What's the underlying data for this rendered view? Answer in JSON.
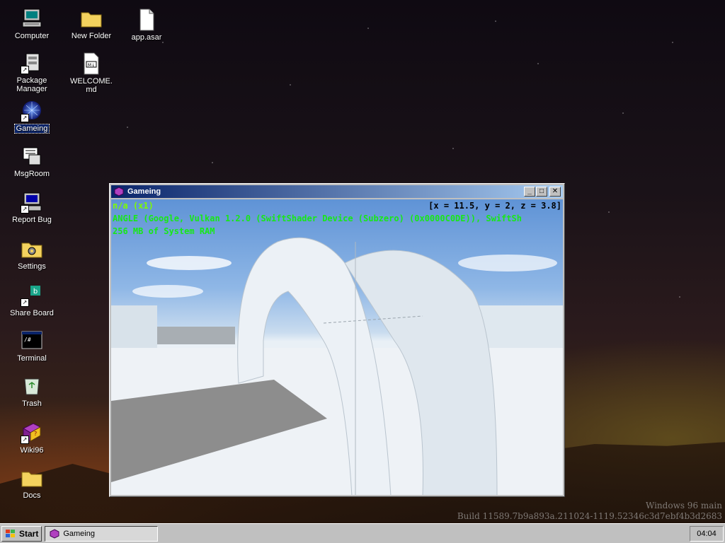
{
  "desktop": {
    "icons": [
      {
        "label": "Computer",
        "icon": "computer-icon"
      },
      {
        "label": "New Folder",
        "icon": "folder-icon"
      },
      {
        "label": "app.asar",
        "icon": "file-icon"
      },
      {
        "label": "Package Manager",
        "icon": "package-manager-icon"
      },
      {
        "label": "WELCOME.md",
        "icon": "markdown-file-icon"
      },
      {
        "label": "Gameing",
        "icon": "gameing-icon"
      },
      {
        "label": "MsgRoom",
        "icon": "msgroom-icon"
      },
      {
        "label": "Report Bug",
        "icon": "report-bug-icon"
      },
      {
        "label": "Settings",
        "icon": "settings-icon"
      },
      {
        "label": "Share Board",
        "icon": "share-board-icon"
      },
      {
        "label": "Terminal",
        "icon": "terminal-icon"
      },
      {
        "label": "Trash",
        "icon": "trash-icon"
      },
      {
        "label": "Wiki96",
        "icon": "wiki-icon"
      },
      {
        "label": "Docs",
        "icon": "folder-icon"
      }
    ],
    "watermark": {
      "line1": "Windows 96 main",
      "line2": "Build 11589.7b9a893a.211024-1119.52346c3d7ebf4b3d2683"
    }
  },
  "window": {
    "title": "Gameing",
    "hud": {
      "renderer_mode": "n/a (x1)",
      "gpu": "ANGLE (Google, Vulkan 1.2.0 (SwiftShader Device (Subzero) (0x0000C0DE)), SwiftSh",
      "memory": "256 MB of System RAM",
      "coords": "[x = 11.5, y = 2, z = 3.8]"
    },
    "buttons": {
      "minimize": "_",
      "maximize": "□",
      "close": "✕"
    }
  },
  "taskbar": {
    "start_label": "Start",
    "tasks": [
      {
        "label": "Gameing"
      }
    ],
    "clock": "04:04"
  },
  "colors": {
    "title_active": "#0a246a",
    "hud_green": "#17e817",
    "chrome": "#c0c0c0"
  }
}
